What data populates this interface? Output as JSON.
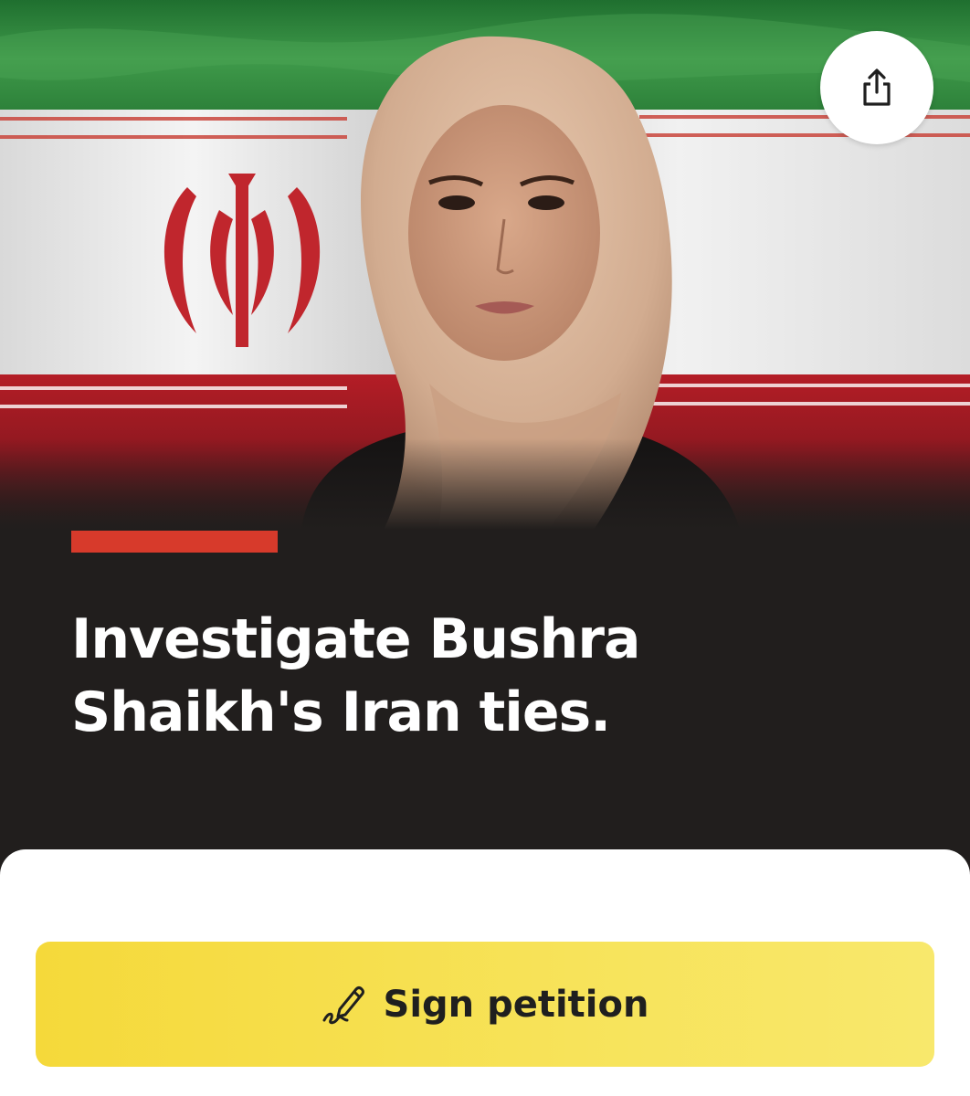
{
  "hero": {
    "image": "portrait-woman-hijab-in-front-of-iran-flag",
    "flag_colors": {
      "green": "#2d8a3e",
      "white": "#f2f2f2",
      "red": "#c8202a"
    }
  },
  "share": {
    "icon": "share-icon"
  },
  "campaign": {
    "accent_color": "#d73a2b",
    "headline_line1": "Investigate Bushra",
    "headline_line2": "Shaikh's Iran ties."
  },
  "cta": {
    "label": "Sign petition",
    "icon": "pen-signature-icon",
    "color": "#f5d93a"
  }
}
